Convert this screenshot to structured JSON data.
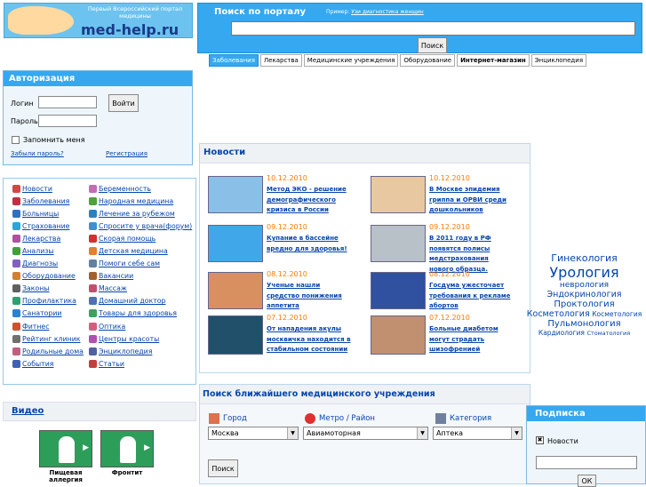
{
  "logo": {
    "slogan": "Первый Всероссийский портал медицины",
    "site": "med-help.ru"
  },
  "search": {
    "title": "Поиск по порталу",
    "example_prefix": "Пример:",
    "example_link": "Узи диагностика женщин",
    "button": "Поиск"
  },
  "tabs": [
    {
      "label": "Заболевания",
      "active": true
    },
    {
      "label": "Лекарства"
    },
    {
      "label": "Медицинские учреждения"
    },
    {
      "label": "Оборудование"
    },
    {
      "label": "Интернет-магазин"
    },
    {
      "label": "Энциклопедия"
    }
  ],
  "auth": {
    "title": "Авторизация",
    "login_label": "Логин",
    "password_label": "Пароль",
    "login_button": "Войти",
    "remember": "Запомнить меня",
    "forgot": "Забыли пароль?",
    "register": "Регистрация"
  },
  "menu_left": [
    {
      "label": "Новости",
      "icon": "news-icon",
      "color": "#d04848"
    },
    {
      "label": "Заболевания",
      "icon": "disease-icon",
      "color": "#c03040"
    },
    {
      "label": "Больницы",
      "icon": "hospital-icon",
      "color": "#3070c0"
    },
    {
      "label": "Страхование",
      "icon": "insurance-icon",
      "color": "#2aa6d8"
    },
    {
      "label": "Лекарства",
      "icon": "pills-icon",
      "color": "#b050a0"
    },
    {
      "label": "Анализы",
      "icon": "analysis-icon",
      "color": "#40a040"
    },
    {
      "label": "Диагнозы",
      "icon": "diagnosis-icon",
      "color": "#8060c0"
    },
    {
      "label": "Оборудование",
      "icon": "equipment-icon",
      "color": "#d08030"
    },
    {
      "label": "Законы",
      "icon": "law-icon",
      "color": "#606060"
    },
    {
      "label": "Профилактика",
      "icon": "prevention-icon",
      "color": "#30a070"
    },
    {
      "label": "Санатории",
      "icon": "sanatorium-icon",
      "color": "#3080d0"
    },
    {
      "label": "Фитнес",
      "icon": "fitness-icon",
      "color": "#d05030"
    },
    {
      "label": "Рейтинг клиник",
      "icon": "rating-icon",
      "color": "#707070"
    },
    {
      "label": "Родильные дома",
      "icon": "maternity-icon",
      "color": "#c06080"
    },
    {
      "label": "События",
      "icon": "events-icon",
      "color": "#4060b0"
    }
  ],
  "menu_right": [
    {
      "label": "Беременность",
      "icon": "pregnancy-icon",
      "color": "#c070b0"
    },
    {
      "label": "Народная медицина",
      "icon": "folk-medicine-icon",
      "color": "#50a040"
    },
    {
      "label": "Лечение за рубежом",
      "icon": "abroad-icon",
      "color": "#3080c0"
    },
    {
      "label": "Спросите у врача(форум)",
      "icon": "forum-icon",
      "color": "#4090d0"
    },
    {
      "label": "Скорая помощь",
      "icon": "ambulance-icon",
      "color": "#d03030"
    },
    {
      "label": "Детская медицина",
      "icon": "child-icon",
      "color": "#e08030"
    },
    {
      "label": "Помоги себе сам",
      "icon": "self-help-icon",
      "color": "#6080a0"
    },
    {
      "label": "Вакансии",
      "icon": "vacancy-icon",
      "color": "#a06030"
    },
    {
      "label": "Массаж",
      "icon": "massage-icon",
      "color": "#c05070"
    },
    {
      "label": "Домашний доктор",
      "icon": "home-doctor-icon",
      "color": "#5070b0"
    },
    {
      "label": "Товары для здоровья",
      "icon": "goods-icon",
      "color": "#40a060"
    },
    {
      "label": "Оптика",
      "icon": "optics-icon",
      "color": "#d06080"
    },
    {
      "label": "Центры красоты",
      "icon": "beauty-icon",
      "color": "#b050b0"
    },
    {
      "label": "Энциклопедия",
      "icon": "encyclopedia-icon",
      "color": "#5060a0"
    },
    {
      "label": "Статьи",
      "icon": "articles-icon",
      "color": "#c04040"
    }
  ],
  "news": {
    "title": "Новости",
    "items": [
      {
        "date": "10.12.2010",
        "title": "Метод ЭКО - решение демографического кризиса в России",
        "img_color": "#8ac0e8"
      },
      {
        "date": "10.12.2010",
        "title": "В Москве эпидемия гриппа и ОРВИ среди дошкольников",
        "img_color": "#e8c8a0"
      },
      {
        "date": "09.12.2010",
        "title": "Купание в бассейне вредно для здоровья!",
        "img_color": "#40a8e8"
      },
      {
        "date": "09.12.2010",
        "title": "В 2011 году в РФ появятся полисы медстрахования нового образца.",
        "img_color": "#b8c0c8"
      },
      {
        "date": "08.12.2010",
        "title": "Ученые нашли средство понижения аппетита",
        "img_color": "#d89060"
      },
      {
        "date": "08.12.2010",
        "title": "Госдума ужесточает требования к рекламе абортов",
        "img_color": "#3050a0"
      },
      {
        "date": "07.12.2010",
        "title": "От нападения акулы москвичка находится в стабильном состоянии",
        "img_color": "#20506a"
      },
      {
        "date": "07.12.2010",
        "title": "Больные диабетом могут страдать шизофренией",
        "img_color": "#c09070"
      }
    ]
  },
  "specialties": [
    {
      "label": "Гинекология",
      "size": 11
    },
    {
      "label": "Урология",
      "size": 16
    },
    {
      "label": "неврология",
      "size": 9
    },
    {
      "label": "Эндокринология",
      "size": 9.5
    },
    {
      "label": "Проктология",
      "size": 10
    },
    {
      "label": "Косметология",
      "size": 9.5
    },
    {
      "label": "Косметология",
      "size": 7.5
    },
    {
      "label": "Пульмонология",
      "size": 10
    },
    {
      "label": "Кардиология",
      "size": 7.5
    },
    {
      "label": "Стоматология",
      "size": 6.5
    }
  ],
  "video": {
    "title": "Видео",
    "items": [
      "Пищевая аллергия",
      "Фронтит"
    ]
  },
  "clinic_search": {
    "title": "Поиск ближайшего медицинского учреждения",
    "city_label": "Город",
    "city_value": "Москва",
    "metro_label": "Метро / Район",
    "metro_value": "Авиамоторная",
    "category_label": "Категория",
    "category_value": "Аптека",
    "button": "Поиск"
  },
  "subscribe": {
    "title": "Подписка",
    "news_label": "Новости",
    "news_checked": true,
    "checked_mark": "✖",
    "button": "ОК"
  }
}
